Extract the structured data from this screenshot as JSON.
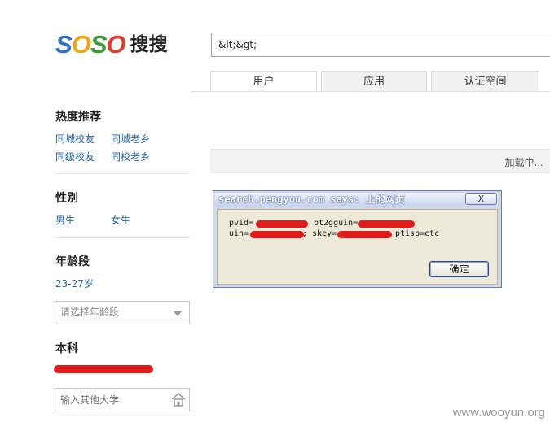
{
  "logo": {
    "brand": [
      "S",
      "O",
      "S",
      "O"
    ],
    "cn": "搜搜"
  },
  "search": {
    "value": "&lt;&gt;"
  },
  "tabs": [
    {
      "label": "用户"
    },
    {
      "label": "应用"
    },
    {
      "label": "认证空间"
    }
  ],
  "sidebar": {
    "hot": {
      "title": "热度推荐",
      "items": [
        "同城校友",
        "同城老乡",
        "同级校友",
        "同校老乡"
      ]
    },
    "gender": {
      "title": "性别",
      "items": [
        "男生",
        "女生"
      ]
    },
    "age": {
      "title": "年龄段",
      "value": "23-27岁",
      "select_placeholder": "请选择年龄段"
    },
    "college": {
      "title": "本科",
      "input_placeholder": "输入其他大学"
    }
  },
  "loading": {
    "text": "加载中..."
  },
  "dialog": {
    "title": "search.pengyou.com says: 上的网页",
    "close": "X",
    "line1_a": "pvid=",
    "line1_b": "pt2gguin=",
    "line2_a": "uin=",
    "line2_b": "; skey=",
    "line2_c": "ptisp=ctc",
    "ok": "确定"
  },
  "watermark": "www.wooyun.org",
  "colors": {
    "link": "#2563a8",
    "redaction": "#e21b1b",
    "dialog_frame": "#6c7aa3"
  }
}
